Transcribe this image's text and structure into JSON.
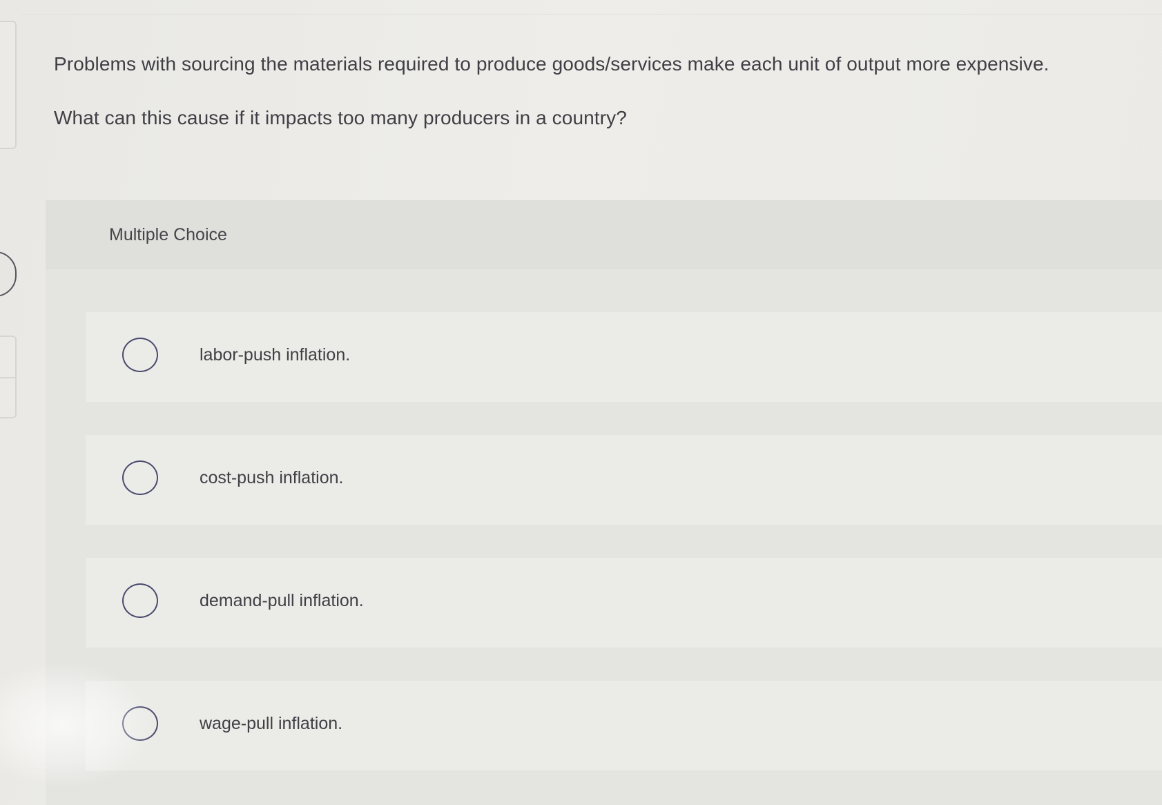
{
  "question": {
    "line1": "Problems with sourcing the materials required to produce goods/services make each unit of output more expensive.",
    "line2": "What can this cause if it impacts too many producers in a country?"
  },
  "multiple_choice": {
    "label": "Multiple Choice",
    "options": [
      {
        "text": "labor-push inflation.",
        "selected": false
      },
      {
        "text": "cost-push inflation.",
        "selected": false
      },
      {
        "text": "demand-pull inflation.",
        "selected": false
      },
      {
        "text": "wage-pull inflation.",
        "selected": false
      }
    ]
  },
  "colors": {
    "radio_border": "#4a4a6e",
    "text": "#3f3f45",
    "panel_background": "#e3e3e0",
    "option_background": "#ebebe8"
  }
}
